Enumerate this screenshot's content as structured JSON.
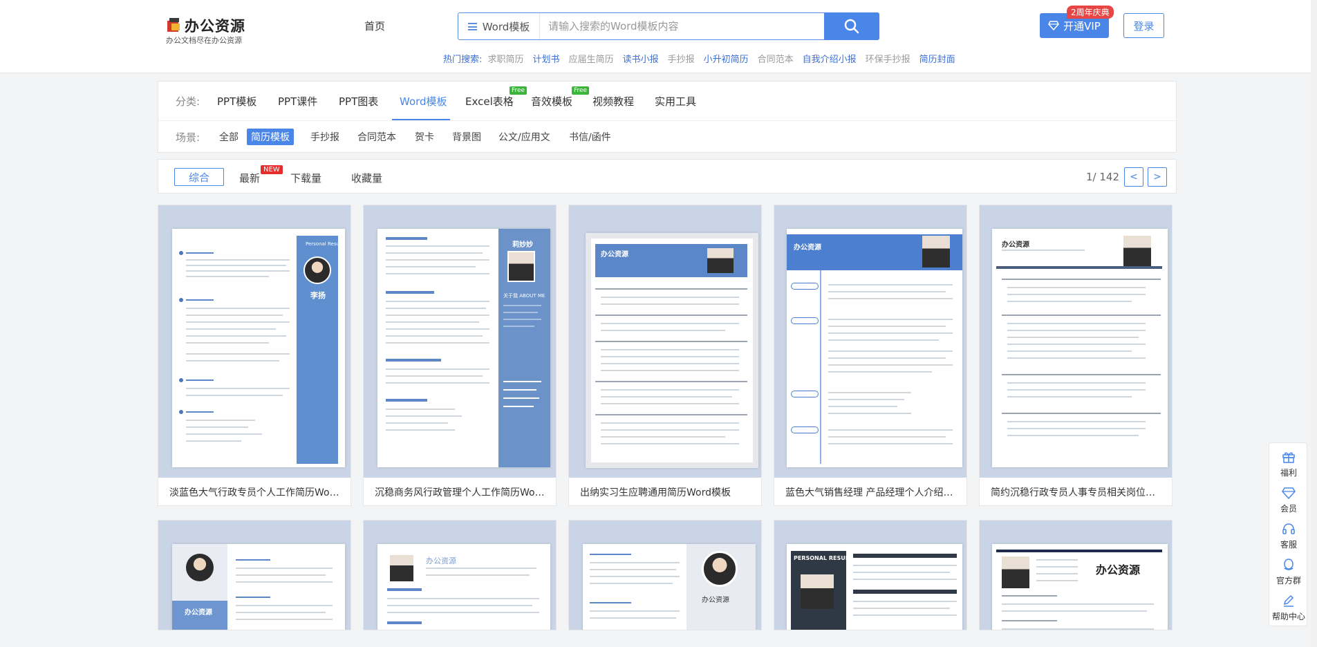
{
  "header": {
    "logo_title": "办公资源",
    "logo_sub": "办公文档尽在办公资源",
    "nav_home": "首页",
    "search": {
      "category": "Word模板",
      "placeholder": "请输入搜索的Word模板内容"
    },
    "hot": {
      "label": "热门搜索:",
      "items": [
        {
          "text": "求职简历",
          "color": "#999999"
        },
        {
          "text": "计划书",
          "color": "#3b6fd8"
        },
        {
          "text": "应届生简历",
          "color": "#999999"
        },
        {
          "text": "读书小报",
          "color": "#3b6fd8"
        },
        {
          "text": "手抄报",
          "color": "#999999"
        },
        {
          "text": "小升初简历",
          "color": "#3b6fd8"
        },
        {
          "text": "合同范本",
          "color": "#999999"
        },
        {
          "text": "自我介绍小报",
          "color": "#3b6fd8"
        },
        {
          "text": "环保手抄报",
          "color": "#999999"
        },
        {
          "text": "简历封面",
          "color": "#3b6fd8"
        }
      ]
    },
    "vip_button": "开通VIP",
    "vip_tag": "2周年庆典",
    "login_button": "登录"
  },
  "filter": {
    "category_label": "分类:",
    "categories": [
      "PPT模板",
      "PPT课件",
      "PPT图表",
      "Word模板",
      "Excel表格",
      "音效模板",
      "视频教程",
      "实用工具"
    ],
    "active_category": "Word模板",
    "free_tag": "Free",
    "scene_label": "场景:",
    "scenes": [
      "全部",
      "简历模板",
      "手抄报",
      "合同范本",
      "贺卡",
      "背景图",
      "公文/应用文",
      "书信/函件"
    ],
    "active_scene": "简历模板"
  },
  "sortbar": {
    "items": [
      "综合",
      "最新",
      "下载量",
      "收藏量"
    ],
    "active": "综合",
    "new_tag": "NEW",
    "pager": "1/ 142",
    "prev": "<",
    "next": ">"
  },
  "cards": [
    {
      "title": "淡蓝色大气行政专员个人工作简历Word模板"
    },
    {
      "title": "沉稳商务风行政管理个人工作简历Word模板"
    },
    {
      "title": "出纳实习生应聘通用简历Word模板"
    },
    {
      "title": "蓝色大气销售经理 产品经理个人介绍简历Word模板"
    },
    {
      "title": "简约沉稳行政专员人事专员相关岗位个人简历Word模板"
    }
  ],
  "thumb_text": {
    "t1_name": "李扬",
    "t1_side": "Personal Resume",
    "t2_name": "莉妙妙",
    "t2_about": "关于我 ABOUT ME",
    "t3_brand": "办公资源",
    "t4_brand": "办公资源",
    "t5_brand": "办公资源",
    "r2_brand1": "办公资源",
    "r2_brand2": "办公资源",
    "r2_brand3": "办公资源",
    "r2_brand4": "PERSONAL RESUME",
    "r2_brand5": "办公资源"
  },
  "floatbar": [
    "福利",
    "会员",
    "客服",
    "官方群",
    "帮助中心"
  ]
}
